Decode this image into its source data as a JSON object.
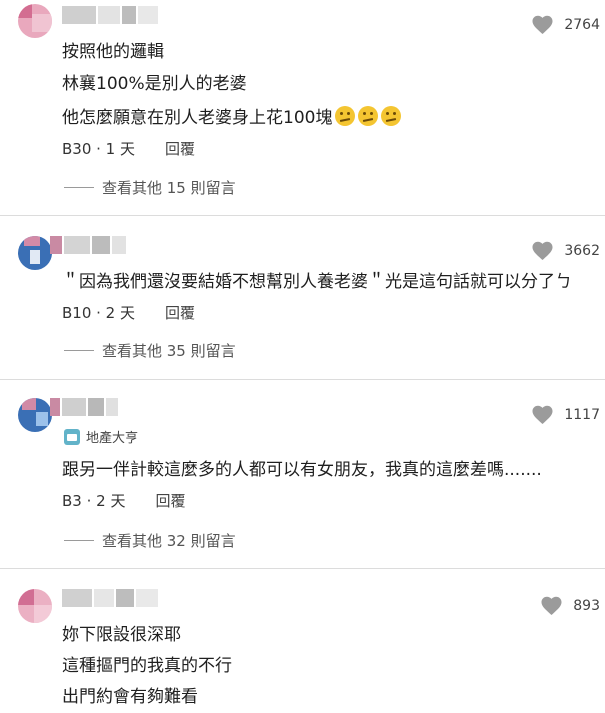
{
  "comments": [
    {
      "likes": "2764",
      "lines": [
        "按照他的邏輯",
        "林襄100%是別人的老婆",
        "他怎麼願意在別人老婆身上花100塊"
      ],
      "emoji_count": 3,
      "floor": "B30 · 1 天",
      "reply_label": "回覆",
      "more_replies": "查看其他 15 則留言"
    },
    {
      "likes": "3662",
      "lines": [
        "＂因為我們還沒要結婚不想幫別人養老婆＂光是這句話就可以分了ㄅ"
      ],
      "floor": "B10 · 2 天",
      "reply_label": "回覆",
      "more_replies": "查看其他 35 則留言"
    },
    {
      "likes": "1117",
      "badge": "地產大亨",
      "lines": [
        "跟另一伴計較這麼多的人都可以有女朋友，我真的這麼差嗎......."
      ],
      "floor": "B3 · 2 天",
      "reply_label": "回覆",
      "more_replies": "查看其他 32 則留言"
    },
    {
      "likes": "893",
      "lines": [
        "妳下限設很深耶",
        "這種摳門的我真的不行",
        "出門約會有夠難看"
      ]
    }
  ]
}
